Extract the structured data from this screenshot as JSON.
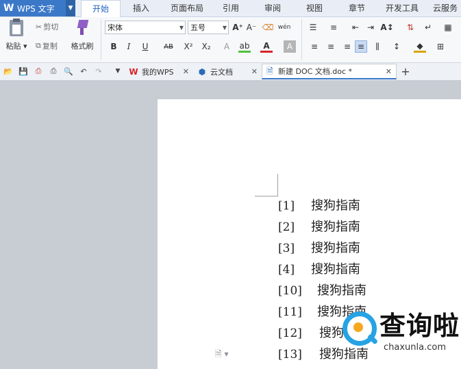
{
  "app": {
    "name": "WPS 文字",
    "logo": "W"
  },
  "menu_tabs": [
    "开始",
    "插入",
    "页面布局",
    "引用",
    "审阅",
    "视图",
    "章节",
    "开发工具",
    "云服务"
  ],
  "menu_active": 0,
  "ribbon": {
    "paste_label": "粘贴",
    "cut_label": "剪切",
    "copy_label": "复制",
    "format_painter_label": "格式刷",
    "font_name": "宋体",
    "font_size": "五号"
  },
  "doc_tabs": [
    {
      "label": "我的WPS",
      "icon": "wps-logo-icon"
    },
    {
      "label": "云文档",
      "icon": "cloud-cube-icon"
    },
    {
      "label": "新建 DOC 文档.doc *",
      "icon": "document-icon"
    }
  ],
  "document": {
    "lines": [
      {
        "num": "[1]",
        "text": "搜狗指南"
      },
      {
        "num": "[2]",
        "text": "搜狗指南"
      },
      {
        "num": "[3]",
        "text": "搜狗指南"
      },
      {
        "num": "[4]",
        "text": "搜狗指南"
      },
      {
        "num": "[10]",
        "text": "搜狗指南"
      },
      {
        "num": "[11]",
        "text": "搜狗指南"
      },
      {
        "num": "[12]",
        "text": "搜狗指南"
      },
      {
        "num": "[13]",
        "text": "搜狗指南"
      }
    ]
  },
  "watermark": {
    "cn": "查询啦",
    "en": "chaxunla.com"
  },
  "colors": {
    "accent": "#3b78c8",
    "watermark_blue": "#27a3e4",
    "watermark_orange": "#f6a821"
  }
}
